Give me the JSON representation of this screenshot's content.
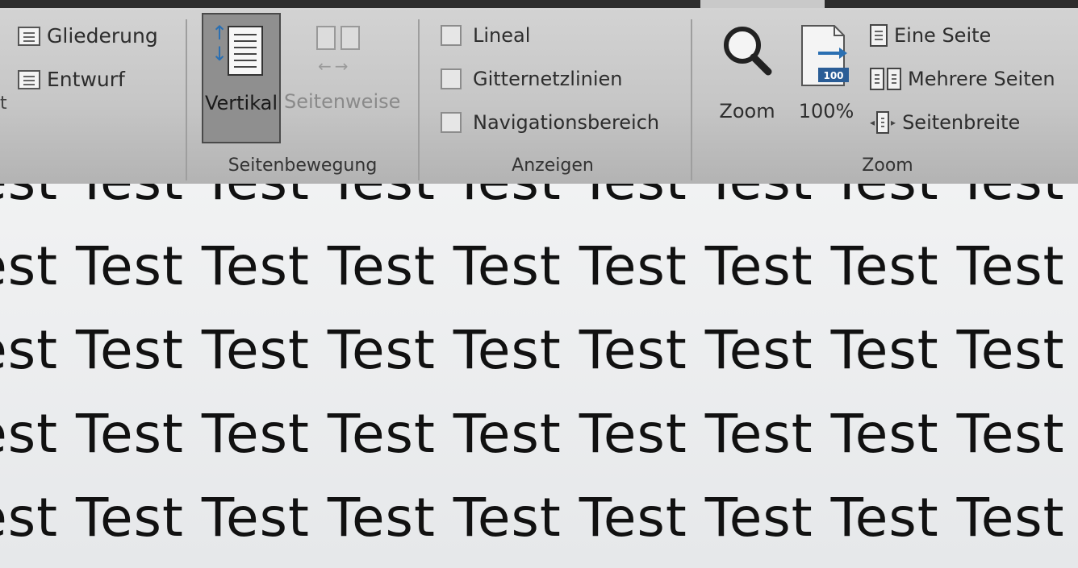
{
  "ribbon": {
    "views": {
      "outline_label": "Gliederung",
      "draft_label": "Entwurf",
      "cut_label": "t"
    },
    "page_movement": {
      "vertical_label": "Vertikal",
      "side_by_side_label": "Seitenweise",
      "group_label": "Seitenbewegung"
    },
    "show": {
      "ruler_label": "Lineal",
      "ruler_checked": false,
      "gridlines_label": "Gitternetzlinien",
      "gridlines_checked": false,
      "navpane_label": "Navigationsbereich",
      "navpane_checked": false,
      "group_label": "Anzeigen"
    },
    "zoom": {
      "zoom_label": "Zoom",
      "hundred_label": "100%",
      "hundred_icon_text": "100",
      "one_page_label": "Eine Seite",
      "multiple_pages_label": "Mehrere Seiten",
      "page_width_label": "Seitenbreite",
      "group_label": "Zoom"
    }
  },
  "document": {
    "lines": [
      "Test Test Test Test Test Test Test Test Test Test",
      "Test Test Test Test Test Test Test Test Test Test",
      "Test Test Test Test Test Test Test Test Test Test",
      "Test Test Test Test Test Test Test Test Test Test",
      "Test Test Test Test Test Test Test Test Test Test"
    ]
  },
  "icons": [
    "outline-icon",
    "draft-icon",
    "vertical-scroll-icon",
    "side-by-side-icon",
    "magnifier-icon",
    "hundred-percent-icon",
    "one-page-icon",
    "multiple-pages-icon",
    "page-width-icon"
  ],
  "colors": {
    "accent_blue": "#2a6fb2",
    "ribbon_bg": "#c6c6c6",
    "document_bg": "#eceef0"
  }
}
